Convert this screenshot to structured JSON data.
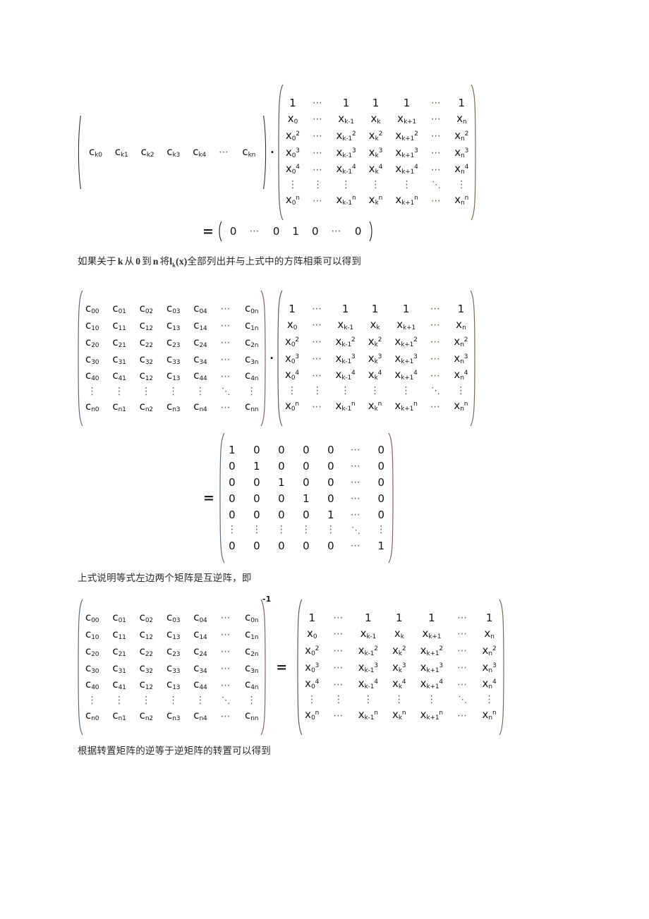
{
  "document": {
    "language": "zh-CN",
    "topic": "Lagrange interpolation / Vandermonde matrix inverse",
    "background_color": "#ffffff",
    "text_color": "#1a1a1a",
    "ellipsis_color": "#6b5a3e"
  },
  "prose": {
    "line1_pre": "如果关于",
    "line1_k": "k",
    "line1_mid1": "从",
    "line1_zero": "0",
    "line1_mid2": "到",
    "line1_n": "n",
    "line1_mid3": "将",
    "line1_lk_base": "l",
    "line1_lk_sub": "k",
    "line1_lk_arg": "(x)",
    "line1_post": "全部列出并与上式中的方阵相乘可以得到",
    "line2": "上式说明等式左边两个矩阵是互逆阵，即",
    "line3": "根据转置矩阵的逆等于逆矩阵的转置可以得到"
  },
  "equations": {
    "eq1": {
      "label": "row-vector times Vandermonde equals unit row vector",
      "row_vector": [
        "c<sub>k0</sub>",
        "c<sub>k1</sub>",
        "c<sub>k2</sub>",
        "c<sub>k3</sub>",
        "c<sub>k4</sub>",
        "⋯",
        "c<sub>kn</sub>"
      ],
      "row_vector_plain": [
        "ck0",
        "ck1",
        "ck2",
        "ck3",
        "ck4",
        "⋯",
        "ckn"
      ],
      "operator": "·",
      "result_operator": "=",
      "result_vector": [
        "0",
        "⋯",
        "0",
        "1",
        "0",
        "⋯",
        "0"
      ]
    },
    "eq2": {
      "label": "C matrix times Vandermonde equals identity",
      "operator": "·",
      "result_operator": "="
    },
    "eq3": {
      "label": "C matrix inverse equals Vandermonde",
      "superscript": "-1",
      "operator": "="
    }
  },
  "matrices": {
    "c_matrix": {
      "name": "coefficient-matrix-C",
      "columns": 7,
      "rows": [
        [
          "c00",
          "c01",
          "c02",
          "c03",
          "c04",
          "⋯",
          "c0n"
        ],
        [
          "c10",
          "c11",
          "c12",
          "c13",
          "c14",
          "⋯",
          "c1n"
        ],
        [
          "c20",
          "c21",
          "c22",
          "c23",
          "c24",
          "⋯",
          "c2n"
        ],
        [
          "c30",
          "c31",
          "c32",
          "c33",
          "c34",
          "⋯",
          "c3n"
        ],
        [
          "c40",
          "c41",
          "c12",
          "c13",
          "c44",
          "⋯",
          "c4n"
        ],
        [
          "⋮",
          "⋮",
          "⋮",
          "⋮",
          "⋮",
          "⋱",
          "⋮"
        ],
        [
          "cn0",
          "cn1",
          "cn2",
          "cn3",
          "cn4",
          "⋯",
          "cnn"
        ]
      ],
      "rows_subscripts": [
        [
          "00",
          "01",
          "02",
          "03",
          "04",
          null,
          "0n"
        ],
        [
          "10",
          "11",
          "12",
          "13",
          "14",
          null,
          "1n"
        ],
        [
          "20",
          "21",
          "22",
          "23",
          "24",
          null,
          "2n"
        ],
        [
          "30",
          "31",
          "32",
          "33",
          "34",
          null,
          "3n"
        ],
        [
          "40",
          "41",
          "12",
          "13",
          "44",
          null,
          "4n"
        ],
        [
          null,
          null,
          null,
          null,
          null,
          null,
          null
        ],
        [
          "n0",
          "n1",
          "n2",
          "n3",
          "n4",
          null,
          "nn"
        ]
      ]
    },
    "vandermonde": {
      "name": "vandermonde-matrix",
      "columns": 7,
      "column_subscripts": [
        "0",
        "⋯",
        "k-1",
        "k",
        "k+1",
        "⋯",
        "n"
      ],
      "row_exponents": [
        "",
        "1",
        "2",
        "3",
        "4",
        "⋮",
        "n"
      ],
      "rows": [
        [
          "1",
          "⋯",
          "1",
          "1",
          "1",
          "⋯",
          "1"
        ],
        [
          "x0",
          "⋯",
          "xk-1",
          "xk",
          "xk+1",
          "⋯",
          "xn"
        ],
        [
          "x0^2",
          "⋯",
          "xk-1^2",
          "xk^2",
          "xk+1^2",
          "⋯",
          "xn^2"
        ],
        [
          "x0^3",
          "⋯",
          "xk-1^3",
          "xk^3",
          "xk+1^3",
          "⋯",
          "xn^3"
        ],
        [
          "x0^4",
          "⋯",
          "xk-1^4",
          "xk^4",
          "xk+1^4",
          "⋯",
          "xn^4"
        ],
        [
          "⋮",
          "⋮",
          "⋮",
          "⋮",
          "⋮",
          "⋱",
          "⋮"
        ],
        [
          "x0^n",
          "⋯",
          "xk-1^n",
          "xk^n",
          "xk+1^n",
          "⋯",
          "xn^n"
        ]
      ]
    },
    "identity": {
      "name": "identity-matrix",
      "columns": 7,
      "rows": [
        [
          "1",
          "0",
          "0",
          "0",
          "0",
          "⋯",
          "0"
        ],
        [
          "0",
          "1",
          "0",
          "0",
          "0",
          "⋯",
          "0"
        ],
        [
          "0",
          "0",
          "1",
          "0",
          "0",
          "⋯",
          "0"
        ],
        [
          "0",
          "0",
          "0",
          "1",
          "0",
          "⋯",
          "0"
        ],
        [
          "0",
          "0",
          "0",
          "0",
          "1",
          "⋯",
          "0"
        ],
        [
          "⋮",
          "⋮",
          "⋮",
          "⋮",
          "⋮",
          "⋱",
          "⋮"
        ],
        [
          "0",
          "0",
          "0",
          "0",
          "0",
          "⋯",
          "1"
        ]
      ]
    }
  },
  "symbols": {
    "dot_operator": "·",
    "equals": "=",
    "hellip": "⋯",
    "vellip": "⋮",
    "dellip": "⋱",
    "inverse_exp": "-1"
  }
}
